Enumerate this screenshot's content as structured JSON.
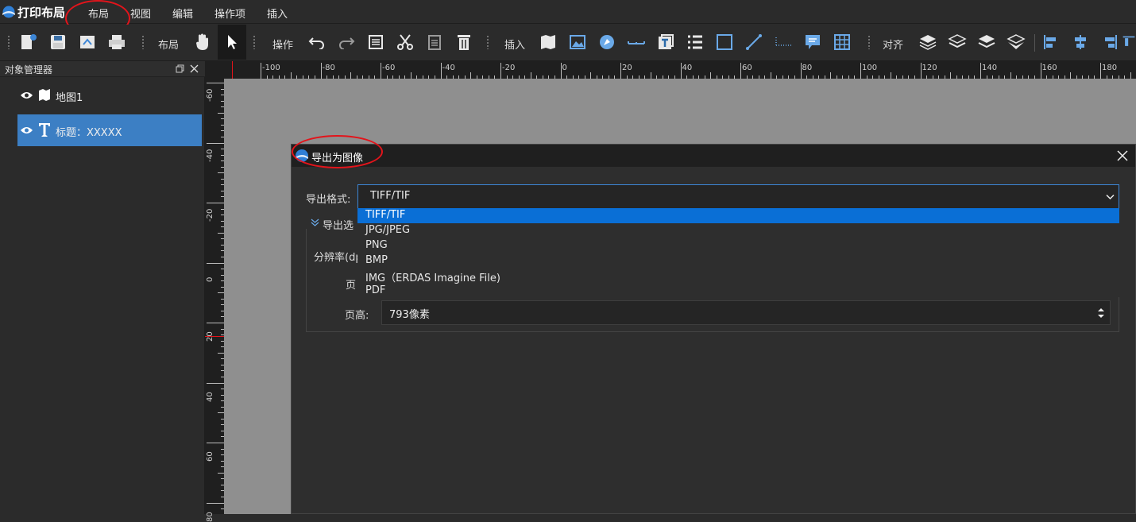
{
  "app": {
    "title": "打印布局"
  },
  "menu": {
    "items": [
      "布局",
      "视图",
      "编辑",
      "操作项",
      "插入"
    ]
  },
  "toolbar": {
    "layout_label": "布局",
    "operation_label": "操作",
    "insert_label": "插入",
    "align_label": "对齐"
  },
  "sidebar": {
    "title": "对象管理器",
    "items": [
      {
        "label": "地图1",
        "icon": "map-icon"
      },
      {
        "label": "标题：XXXXX",
        "icon": "text-icon"
      }
    ]
  },
  "ruler": {
    "top_labels": [
      "-100",
      "-80",
      "-60",
      "-40",
      "-20",
      "0",
      "20",
      "40",
      "60",
      "80",
      "100",
      "120",
      "140",
      "160",
      "180"
    ],
    "left_labels": [
      "-60",
      "-40",
      "-20",
      "0",
      "20",
      "40",
      "60",
      "80"
    ]
  },
  "dialog": {
    "title": "导出为图像",
    "format_label": "导出格式:",
    "format_value": "TIFF/TIF",
    "format_options": [
      "TIFF/TIF",
      "JPG/JPEG",
      "PNG",
      "BMP",
      "IMG（ERDAS Imagine File)",
      "PDF"
    ],
    "options_section": "导出选",
    "resolution_label": "分辨率(dp",
    "page_width_label": "页",
    "page_height_label": "页高:",
    "page_height_value": "793像素"
  },
  "colors": {
    "accent": "#0a6fd6",
    "highlight": "#3d86d6",
    "annotation": "#e3141b",
    "selected_item": "#3c7fc4"
  }
}
